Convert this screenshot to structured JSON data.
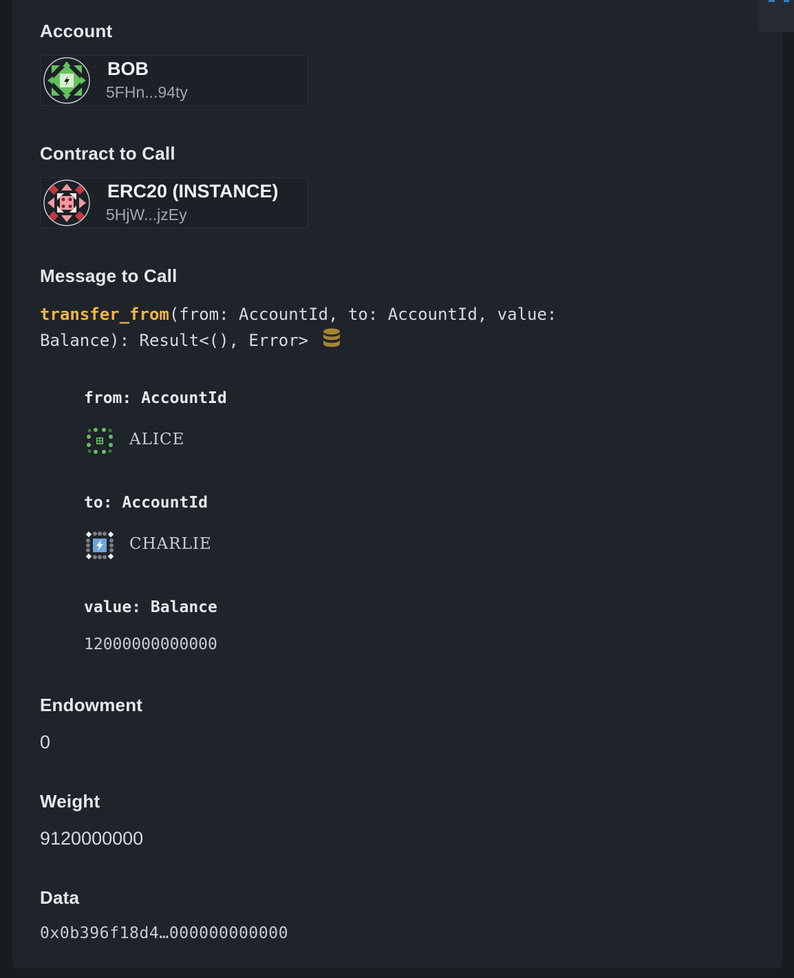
{
  "account": {
    "label": "Account",
    "name": "BOB",
    "address": "5FHn...94ty",
    "avatar_icon": "identicon-green"
  },
  "contract": {
    "label": "Contract to Call",
    "name": "ERC20 (INSTANCE)",
    "address": "5HjW...jzEy",
    "avatar_icon": "identicon-red"
  },
  "message": {
    "label": "Message to Call",
    "fn_name": "transfer_from",
    "signature_rest_line1": "(from: AccountId, to: AccountId, value:",
    "signature_line2": "Balance): Result<(), Error>",
    "mutates_icon": "database-icon",
    "args": [
      {
        "label": "from: AccountId",
        "value": "ALICE",
        "icon": "identicon-green-small"
      },
      {
        "label": "to: AccountId",
        "value": "CHARLIE",
        "icon": "identicon-blue-small"
      },
      {
        "label": "value: Balance",
        "value": "12000000000000"
      }
    ]
  },
  "endowment": {
    "label": "Endowment",
    "value": "0"
  },
  "weight": {
    "label": "Weight",
    "value": "9120000000"
  },
  "data": {
    "label": "Data",
    "value": "0x0b396f18d4…000000000000"
  },
  "colors": {
    "background": "#181b20",
    "panel": "#1f232a",
    "fn_accent": "#f2b441",
    "db_icon": "#a5852f"
  }
}
